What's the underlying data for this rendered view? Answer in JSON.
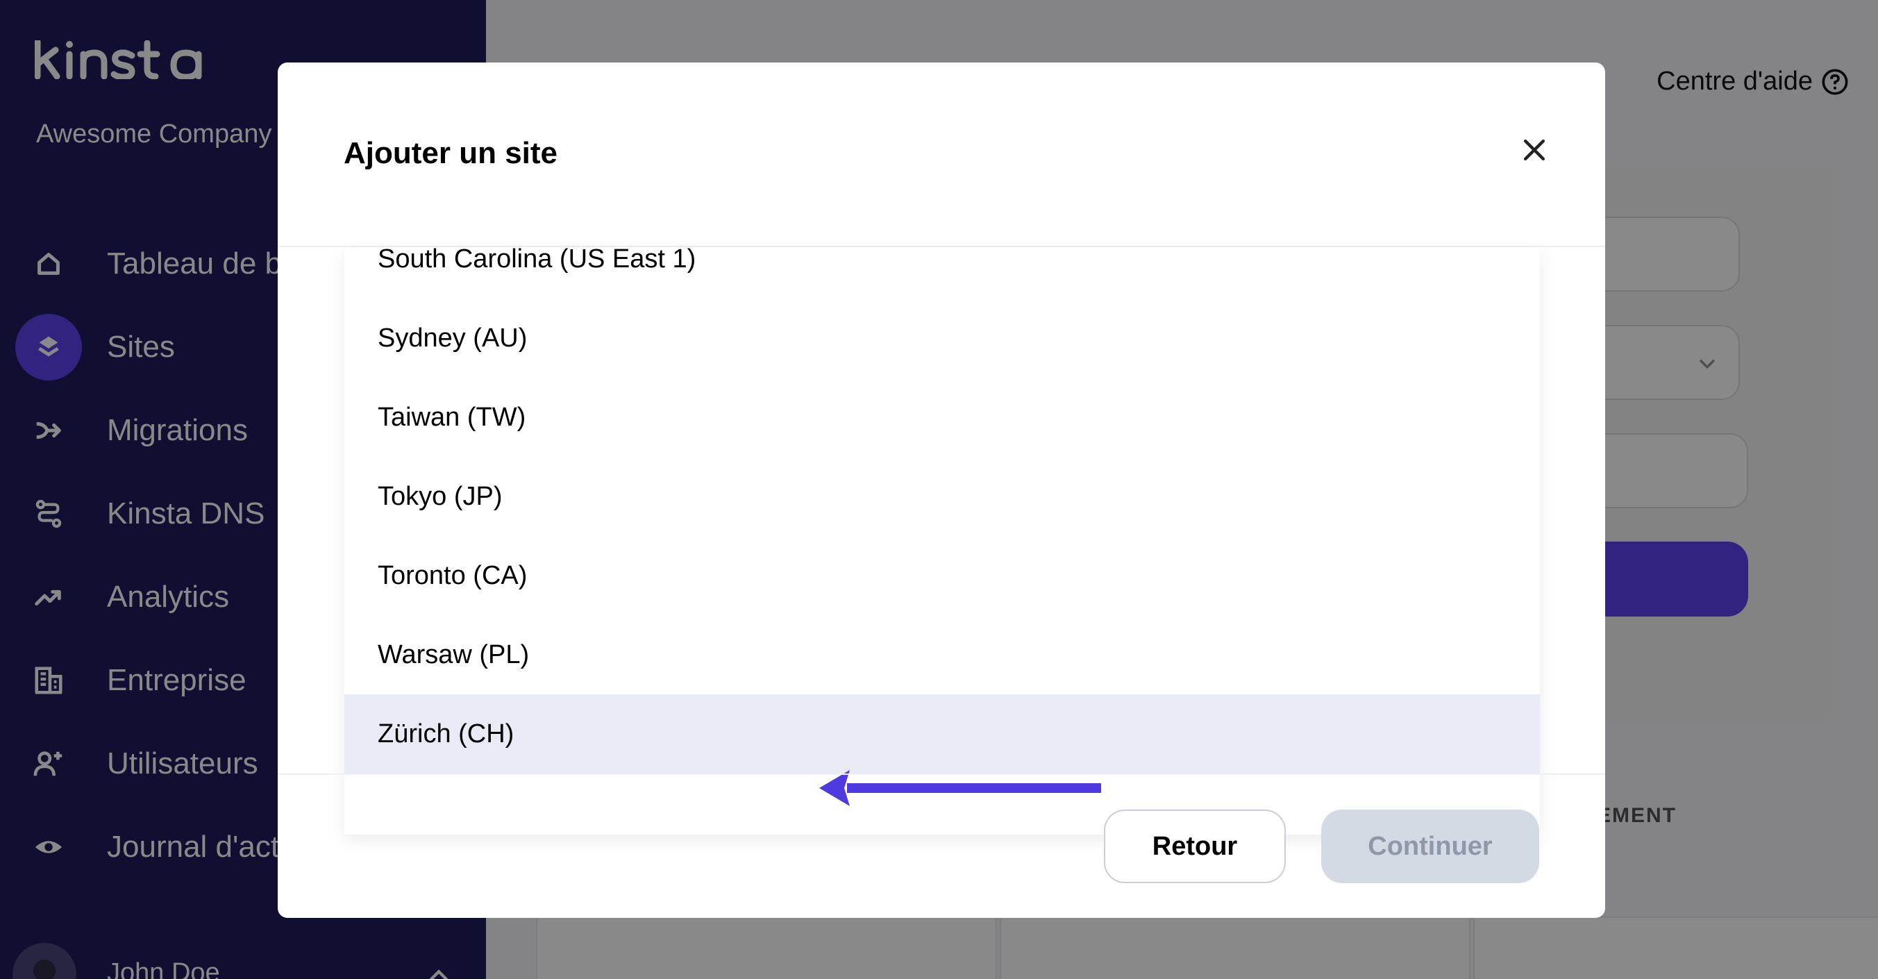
{
  "brand": {
    "logo_text": "KINSTA",
    "company": "Awesome Company"
  },
  "sidebar": {
    "items": [
      {
        "label": "Tableau de bord",
        "icon": "home-icon",
        "active": false
      },
      {
        "label": "Sites",
        "icon": "layers-icon",
        "active": true
      },
      {
        "label": "Migrations",
        "icon": "migrations-icon",
        "active": false
      },
      {
        "label": "Kinsta DNS",
        "icon": "dns-icon",
        "active": false
      },
      {
        "label": "Analytics",
        "icon": "trend-icon",
        "active": false
      },
      {
        "label": "Entreprise",
        "icon": "building-icon",
        "active": false
      },
      {
        "label": "Utilisateurs",
        "icon": "add-user-icon",
        "active": false
      },
      {
        "label": "Journal d'activité",
        "icon": "eye-icon",
        "active": false
      }
    ],
    "user": {
      "name": "John Doe"
    }
  },
  "header": {
    "help_label": "Centre d'aide"
  },
  "background": {
    "column_header": "EMENT"
  },
  "modal": {
    "title": "Ajouter un site",
    "locations": [
      "South Carolina (US East 1)",
      "Sydney (AU)",
      "Taiwan (TW)",
      "Tokyo (JP)",
      "Toronto (CA)",
      "Warsaw (PL)",
      "Zürich (CH)"
    ],
    "selected_location": "Zürich (CH)",
    "back_label": "Retour",
    "continue_label": "Continuer"
  },
  "colors": {
    "sidebar_bg": "#0e0a4f",
    "accent": "#5333ed",
    "selected_row": "#e8eaf6",
    "disabled_button": "#d4dae4"
  }
}
